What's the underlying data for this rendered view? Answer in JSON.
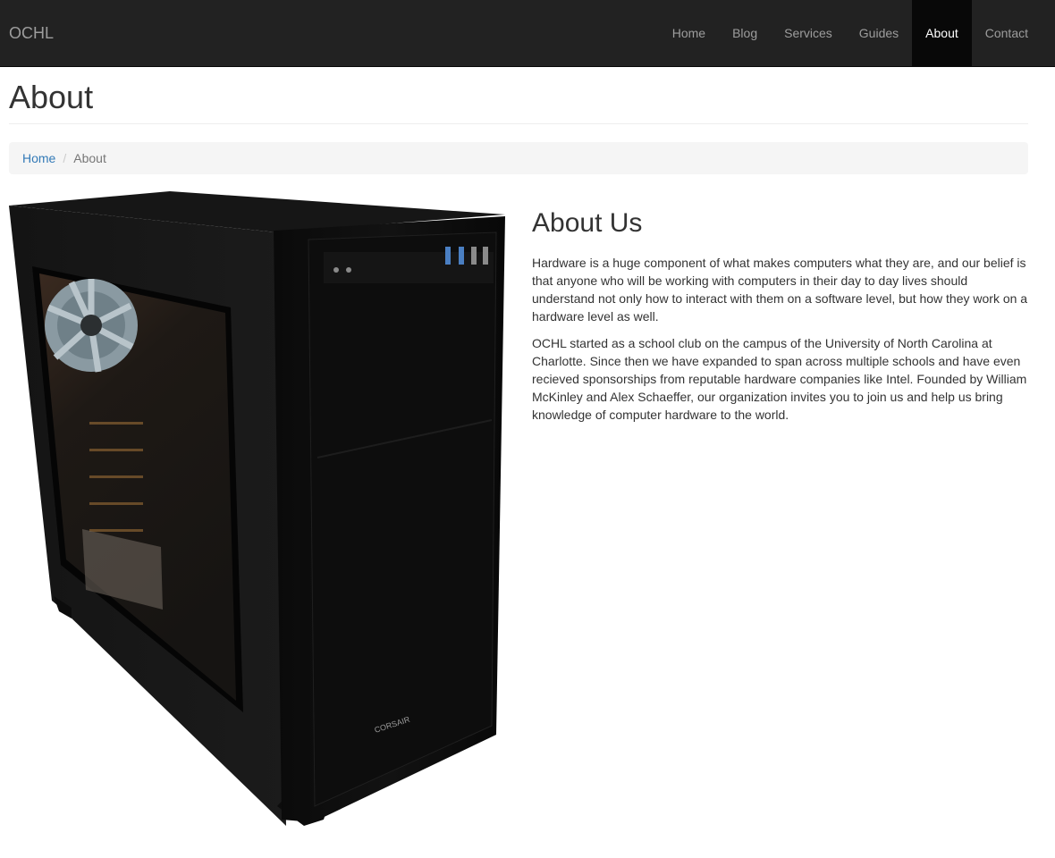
{
  "navbar": {
    "brand": "OCHL",
    "items": [
      {
        "label": "Home"
      },
      {
        "label": "Blog"
      },
      {
        "label": "Services"
      },
      {
        "label": "Guides"
      },
      {
        "label": "About",
        "active": true
      },
      {
        "label": "Contact"
      }
    ]
  },
  "page": {
    "title": "About"
  },
  "breadcrumb": {
    "home": "Home",
    "current": "About"
  },
  "image": {
    "brand_logo": "CORSAIR"
  },
  "about": {
    "heading": "About Us",
    "paragraphs": [
      "Hardware is a huge component of what makes computers what they are, and our belief is that anyone who will be working with computers in their day to day lives should understand not only how to interact with them on a software level, but how they work on a hardware level as well.",
      "OCHL started as a school club on the campus of the University of North Carolina at Charlotte. Since then we have expanded to span across multiple schools and have even recieved sponsorships from reputable hardware companies like Intel. Founded by William McKinley and Alex Schaeffer, our organization invites you to join us and help us bring knowledge of computer hardware to the world."
    ]
  },
  "colors": {
    "navbar_bg": "#222222",
    "nav_active_bg": "#080808",
    "link": "#337ab7",
    "breadcrumb_bg": "#f5f5f5"
  }
}
